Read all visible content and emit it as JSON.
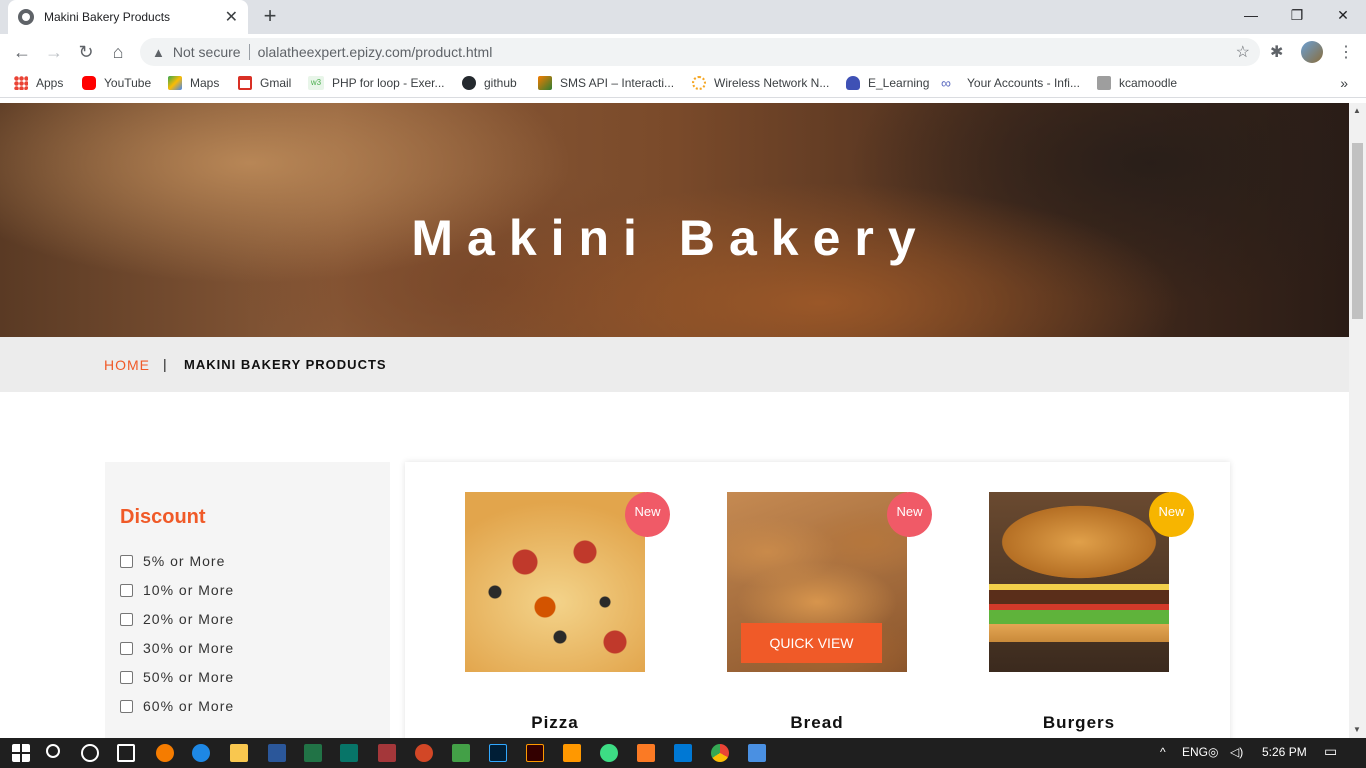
{
  "browser": {
    "tab_title": "Makini Bakery Products",
    "tab_close": "✕",
    "new_tab": "+",
    "window_minimize": "—",
    "window_restore": "❐",
    "window_close": "✕",
    "back": "←",
    "forward": "→",
    "reload": "↻",
    "home": "⌂",
    "security_icon": "▲",
    "security_label": "Not secure",
    "url": "olalatheexpert.epizy.com/product.html",
    "bookmark_star": "☆",
    "extensions": "✱",
    "menu": "⋮"
  },
  "bookmarks": [
    {
      "label": "Apps",
      "icon": "apps-grid-icon",
      "color": "#ea4335"
    },
    {
      "label": "YouTube",
      "icon": "youtube-icon",
      "color": "#ff0000"
    },
    {
      "label": "Maps",
      "icon": "maps-icon",
      "color": "#34a853"
    },
    {
      "label": "Gmail",
      "icon": "gmail-icon",
      "color": "#d93025"
    },
    {
      "label": "PHP for loop - Exer...",
      "icon": "w3schools-icon",
      "color": "#4caf50"
    },
    {
      "label": "github",
      "icon": "github-icon",
      "color": "#24292e"
    },
    {
      "label": "SMS API – Interacti...",
      "icon": "africastalking-icon",
      "color": "#f57c00"
    },
    {
      "label": "Wireless Network N...",
      "icon": "wireless-icon",
      "color": "#f5a623"
    },
    {
      "label": "E_Learning",
      "icon": "elearning-icon",
      "color": "#3f51b5"
    },
    {
      "label": "Your Accounts - Infi...",
      "icon": "infinity-icon",
      "color": "#5c6bc0"
    },
    {
      "label": "kcamoodle",
      "icon": "moodle-icon",
      "color": "#777777"
    }
  ],
  "bookmarks_more": "»",
  "page": {
    "hero_title": "Makini Bakery",
    "breadcrumb": {
      "home": "HOME",
      "separator": "|",
      "current": "MAKINI BAKERY PRODUCTS"
    },
    "filter": {
      "title": "Discount",
      "options": [
        "5% or More",
        "10% or More",
        "20% or More",
        "30% or More",
        "50% or More",
        "60% or More"
      ]
    },
    "products": [
      {
        "name": "Pizza",
        "badge": "New",
        "badge_color": "#f05a67"
      },
      {
        "name": "Bread",
        "badge": "New",
        "badge_color": "#f05a67",
        "quick_view": "QUICK VIEW"
      },
      {
        "name": "Burgers",
        "badge": "New",
        "badge_color": "#f7b500"
      }
    ]
  },
  "colors": {
    "accent": "#f05a28",
    "breadcrumb_bg": "#ececec",
    "sidebar_bg": "#f5f5f5"
  },
  "taskbar": {
    "time": "5:26 PM",
    "tray_language": "ENG",
    "apps": [
      "start-icon",
      "search-icon",
      "cortana-icon",
      "task-view-icon",
      "file-explorer-icon",
      "edge-icon",
      "folder-icon",
      "word-icon",
      "excel-icon",
      "publisher-icon",
      "access-icon",
      "powerpoint-icon",
      "green-app-icon",
      "photoshop-icon",
      "illustrator-icon",
      "sublime-icon",
      "android-studio-icon",
      "xampp-icon",
      "vscode-icon",
      "chrome-icon",
      "photos-icon"
    ]
  }
}
